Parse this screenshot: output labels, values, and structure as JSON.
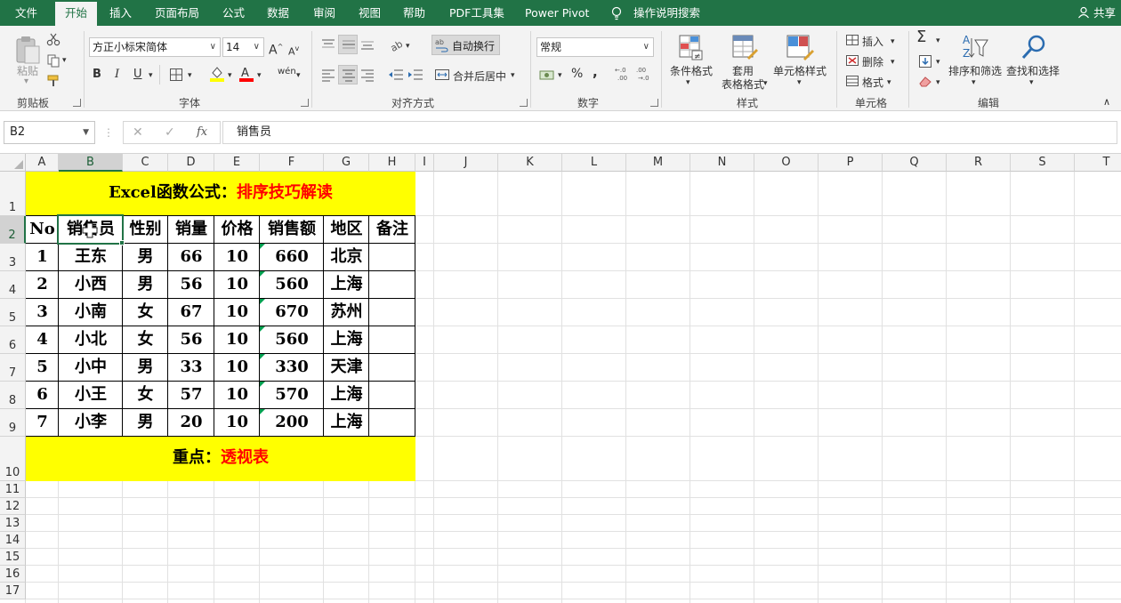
{
  "tabs": [
    "文件",
    "开始",
    "插入",
    "页面布局",
    "公式",
    "数据",
    "审阅",
    "视图",
    "帮助",
    "PDF工具集",
    "Power Pivot",
    "操作说明搜索"
  ],
  "active_tab": "开始",
  "share_label": "共享",
  "ribbon": {
    "clipboard": {
      "paste": "粘贴",
      "group": "剪贴板"
    },
    "font": {
      "family": "方正小标宋简体",
      "size": "14",
      "bold": "B",
      "italic": "I",
      "underline": "U",
      "group": "字体",
      "grow": "A",
      "shrink": "A",
      "phonetic": "wén"
    },
    "align": {
      "wrap_text": "自动换行",
      "merge_center": "合并后居中",
      "group": "对齐方式"
    },
    "number": {
      "format": "常规",
      "percent": "%",
      "comma": ",",
      "group": "数字"
    },
    "styles": {
      "conditional": "条件格式",
      "table_1": "套用",
      "table_2": "表格格式",
      "cell_styles": "单元格样式",
      "group": "样式"
    },
    "cells": {
      "insert": "插入",
      "delete": "删除",
      "format": "格式",
      "group": "单元格"
    },
    "editing": {
      "sort_filter": "排序和筛选",
      "find_select": "查找和选择",
      "group": "编辑"
    }
  },
  "formula_bar": {
    "name_box": "B2",
    "fx": "fx",
    "content": "销售员"
  },
  "columns": [
    "A",
    "B",
    "C",
    "D",
    "E",
    "F",
    "G",
    "H",
    "I",
    "J",
    "K",
    "L",
    "M",
    "N",
    "O",
    "P",
    "Q",
    "R",
    "S",
    "T"
  ],
  "selected_column": "B",
  "rows": [
    "1",
    "2",
    "3",
    "4",
    "5",
    "6",
    "7",
    "8",
    "9",
    "10",
    "11",
    "12",
    "13",
    "14",
    "15",
    "16",
    "17"
  ],
  "selected_row": "2",
  "sheet": {
    "title_black": "Excel函数公式：",
    "title_red": "排序技巧解读",
    "headers": [
      "No",
      "销售员",
      "性别",
      "销量",
      "价格",
      "销售额",
      "地区",
      "备注"
    ],
    "data": [
      [
        "1",
        "王东",
        "男",
        "66",
        "10",
        "660",
        "北京",
        ""
      ],
      [
        "2",
        "小西",
        "男",
        "56",
        "10",
        "560",
        "上海",
        ""
      ],
      [
        "3",
        "小南",
        "女",
        "67",
        "10",
        "670",
        "苏州",
        ""
      ],
      [
        "4",
        "小北",
        "女",
        "56",
        "10",
        "560",
        "上海",
        ""
      ],
      [
        "5",
        "小中",
        "男",
        "33",
        "10",
        "330",
        "天津",
        ""
      ],
      [
        "6",
        "小王",
        "女",
        "57",
        "10",
        "570",
        "上海",
        ""
      ],
      [
        "7",
        "小李",
        "男",
        "20",
        "10",
        "200",
        "上海",
        ""
      ]
    ],
    "footer_black": "重点：",
    "footer_red": "透视表"
  },
  "colors": {
    "brand": "#217346",
    "highlight": "#ffff00",
    "accent_text": "#ff0000"
  }
}
